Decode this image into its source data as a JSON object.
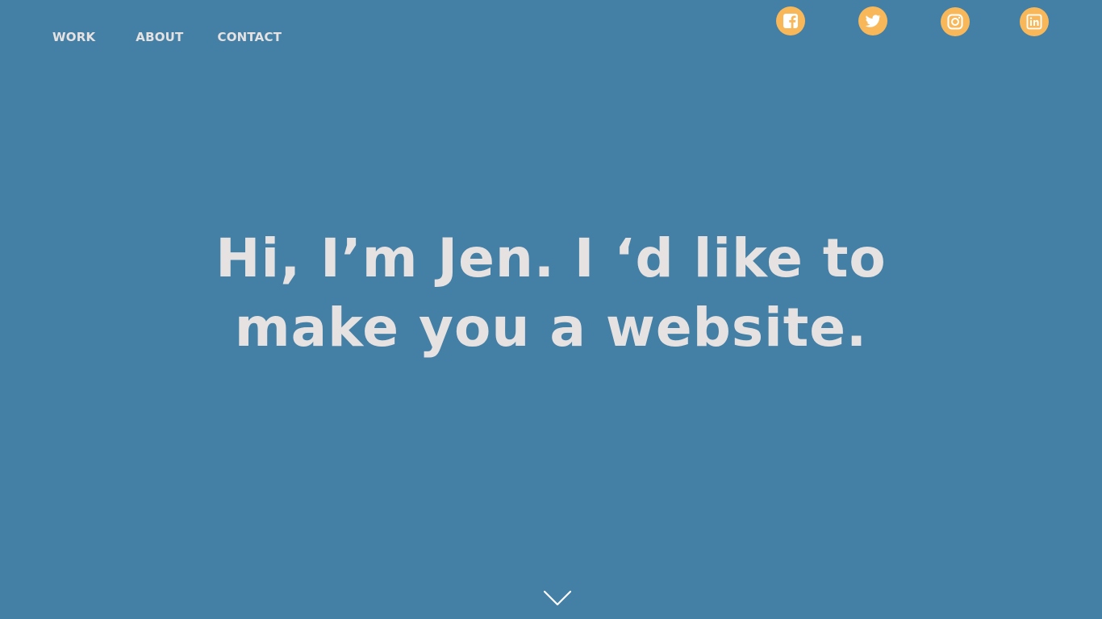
{
  "nav": {
    "items": [
      {
        "label": "WORK"
      },
      {
        "label": "ABOUT"
      },
      {
        "label": "CONTACT"
      }
    ]
  },
  "social": {
    "icons": [
      "facebook-icon",
      "twitter-icon",
      "instagram-icon",
      "linkedin-icon"
    ],
    "icon_bg": "#f8b85a",
    "icon_fg": "#ffffff"
  },
  "hero": {
    "line1": "Hi, I’m Jen. I ‘d like to",
    "line2": "make you a website."
  },
  "scroll": {
    "icon": "chevron-down-icon"
  },
  "colors": {
    "background": "#4480a5",
    "text": "#e6e2e2",
    "accent": "#f8b85a"
  }
}
